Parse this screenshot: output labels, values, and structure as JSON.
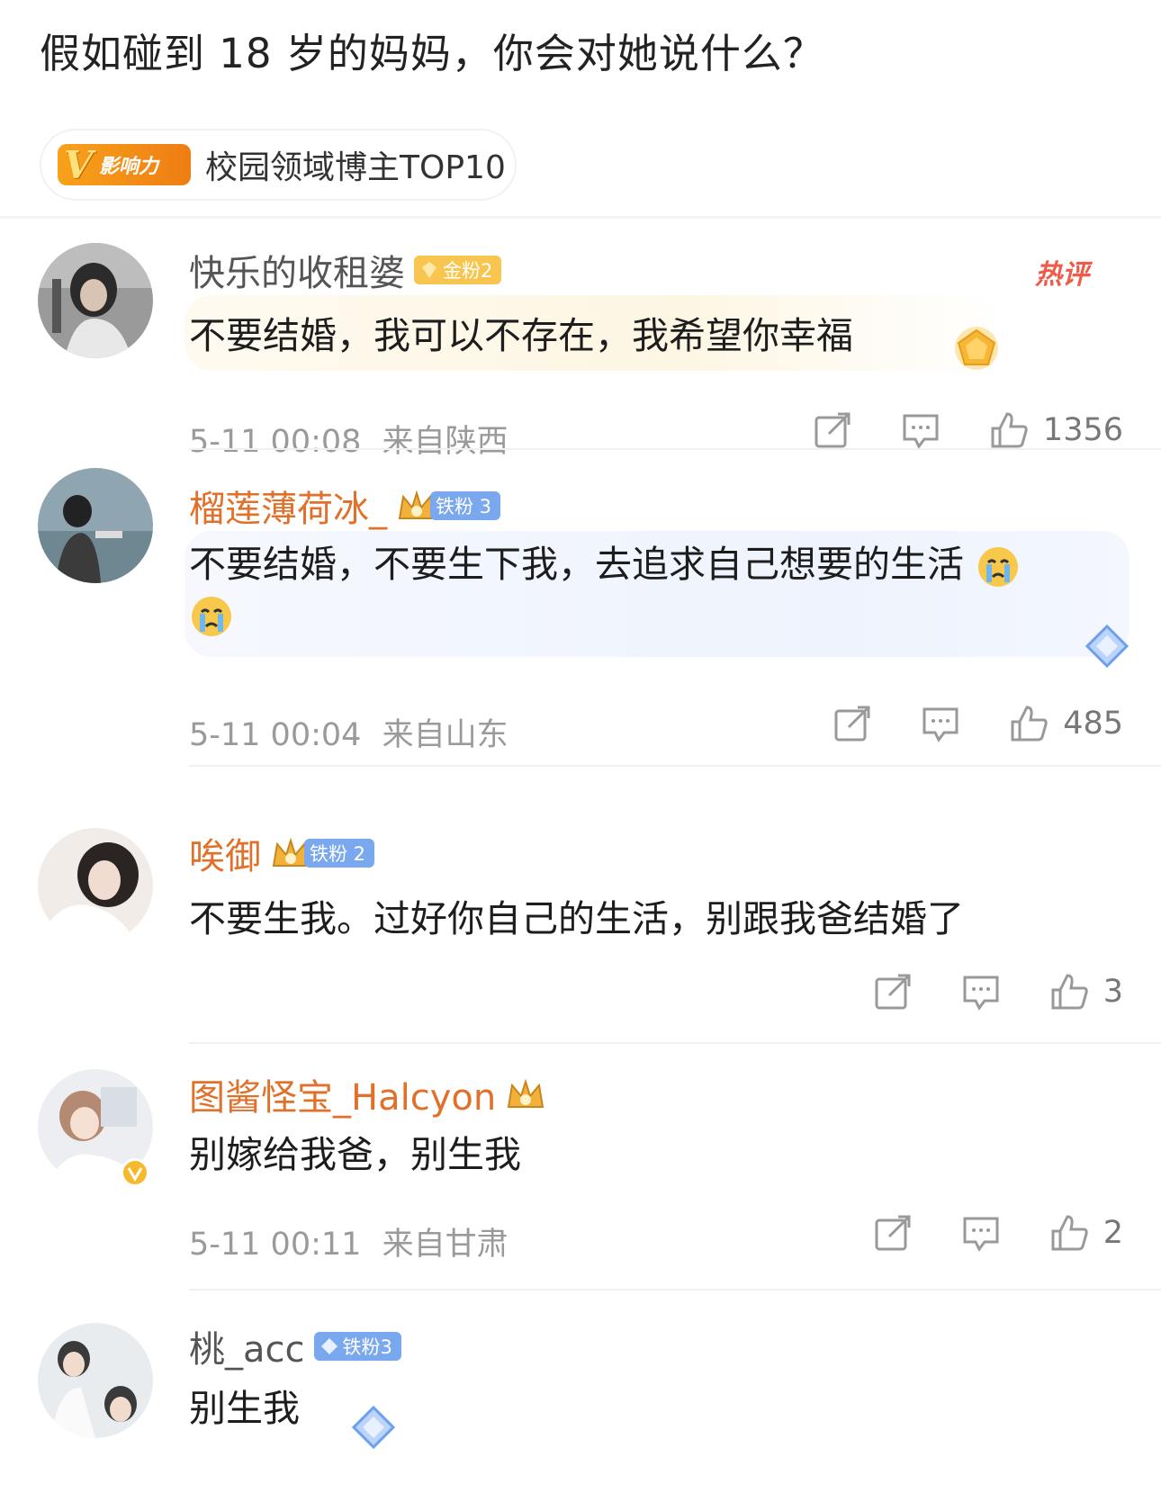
{
  "post": {
    "title": "假如碰到 18 岁的妈妈，你会对她说什么？",
    "badge_v": "V",
    "badge_word": "影响力",
    "badge_label": "校园领域博主TOP10"
  },
  "comments": [
    {
      "username": "快乐的收租婆",
      "fan_badge": "金粉2",
      "hot_tag": "热评",
      "text": "不要结婚，我可以不存在，我希望你幸福",
      "time": "5-11 00:08",
      "location": "来自陕西",
      "likes": "1356"
    },
    {
      "username": "榴莲薄荷冰_",
      "fan_badge": "铁粉 3",
      "text": "不要结婚，不要生下我，去追求自己想要的生活",
      "time": "5-11 00:04",
      "location": "来自山东",
      "likes": "485"
    },
    {
      "username": "唉御",
      "fan_badge": "铁粉 2",
      "text": "不要生我。过好你自己的生活，别跟我爸结婚了",
      "likes": "3"
    },
    {
      "username": "图酱怪宝_Halcyon",
      "text": "别嫁给我爸，别生我",
      "time": "5-11 00:11",
      "location": "来自甘肃",
      "likes": "2"
    },
    {
      "username": "桃_acc",
      "fan_badge": "铁粉3",
      "text": "别生我"
    }
  ],
  "colors": {
    "username_orange": "#e0702a",
    "username_gray": "#555555",
    "meta_gray": "#9a9a9a",
    "hot_red": "#ef5b4b",
    "gold_badge": "#f8c64e",
    "blue_badge": "#7aa8ee"
  }
}
